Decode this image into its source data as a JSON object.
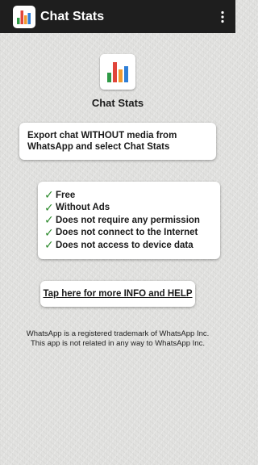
{
  "appbar": {
    "title": "Chat Stats",
    "logo_icon": "bar-chart-icon",
    "menu_icon": "more-vertical-icon"
  },
  "main": {
    "logo_icon": "bar-chart-icon",
    "title": "Chat Stats",
    "export_instruction": "Export chat WITHOUT media from WhatsApp and select Chat Stats",
    "features": [
      "Free",
      "Without Ads",
      "Does not require any permission",
      "Does not connect to the Internet",
      "Does not access to device data"
    ],
    "check_icon": "✓",
    "help_button_label": "Tap here for more INFO and HELP",
    "disclaimer_line1": "WhatsApp is a registered trademark of WhatsApp Inc.",
    "disclaimer_line2": "This app is not related in any way to WhatsApp Inc."
  },
  "colors": {
    "appbar_bg": "#1e1e1e",
    "bar_green": "#2e9a46",
    "bar_red": "#e0453a",
    "bar_orange": "#f29a2e",
    "bar_blue": "#2f7fd6",
    "check_green": "#2e8b2e"
  }
}
